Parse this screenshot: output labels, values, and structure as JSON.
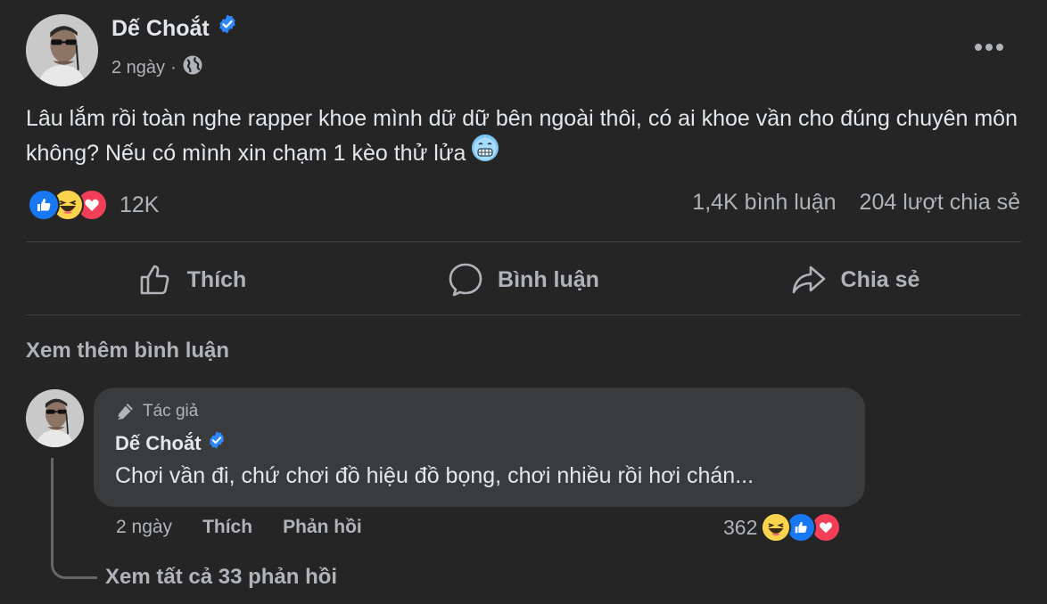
{
  "post": {
    "author": "Dế Choắt",
    "time": "2 ngày",
    "separator": "·",
    "text": "Lâu lắm rồi toàn nghe rapper khoe mình dữ dữ bên ngoài thôi, có ai khoe vần cho đúng chuyên môn không? Nếu có mình xin chạm 1 kèo thử lửa",
    "reaction_count": "12K",
    "comment_count": "1,4K bình luận",
    "share_count": "204 lượt chia sẻ"
  },
  "actions": {
    "like": "Thích",
    "comment": "Bình luận",
    "share": "Chia sẻ"
  },
  "see_more_comments": "Xem thêm bình luận",
  "comment": {
    "badge": "Tác giả",
    "author": "Dế Choắt",
    "text": "Chơi vần đi, chứ chơi đồ hiệu đồ bọng, chơi nhiều rồi hơi chán...",
    "time": "2 ngày",
    "like": "Thích",
    "reply": "Phản hồi",
    "reaction_count": "362",
    "view_replies": "Xem tất cả 33 phản hồi"
  },
  "colors": {
    "background": "#252526",
    "bubble": "#3a3b3c",
    "text_primary": "#e4e6eb",
    "text_secondary": "#b0b3b8",
    "verified_blue": "#2d88ff",
    "like_blue": "#1877f2",
    "love_red": "#f33e58",
    "haha_yellow": "#fcd34d"
  },
  "icons": {
    "verified": "verified-badge-icon",
    "privacy": "globe-icon",
    "more": "more-horizontal-icon",
    "like": "thumbs-up-icon",
    "comment": "speech-bubble-icon",
    "share": "share-arrow-icon",
    "author_badge": "pencil-icon",
    "post_emoji": "cold-face-emoji"
  }
}
